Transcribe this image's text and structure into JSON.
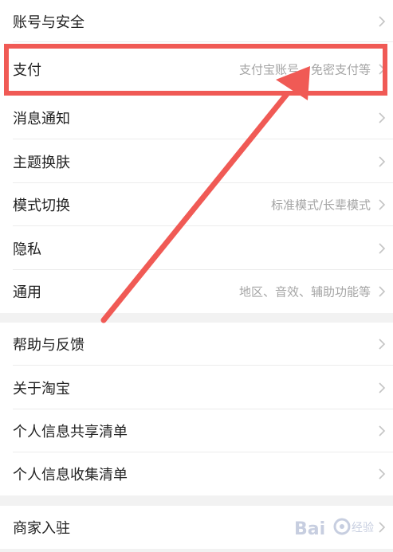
{
  "settings": {
    "items": [
      {
        "label": "账号与安全",
        "sub": ""
      },
      {
        "label": "支付",
        "sub": "支付宝账号、免密支付等"
      },
      {
        "label": "消息通知",
        "sub": ""
      },
      {
        "label": "主题换肤",
        "sub": ""
      },
      {
        "label": "模式切换",
        "sub": "标准模式/长辈模式"
      },
      {
        "label": "隐私",
        "sub": ""
      },
      {
        "label": "通用",
        "sub": "地区、音效、辅助功能等"
      },
      {
        "label": "帮助与反馈",
        "sub": ""
      },
      {
        "label": "关于淘宝",
        "sub": ""
      },
      {
        "label": "个人信息共享清单",
        "sub": ""
      },
      {
        "label": "个人信息收集清单",
        "sub": ""
      },
      {
        "label": "商家入驻",
        "sub": ""
      }
    ]
  },
  "annotation": {
    "color": "#f05a55"
  },
  "watermark": {
    "text": "Baidu 经验"
  },
  "colors": {
    "background": "#f2f2f2",
    "row": "#ffffff",
    "label": "#222222",
    "subtitle": "#a5a5a5",
    "chevron": "#c4c4c4"
  }
}
